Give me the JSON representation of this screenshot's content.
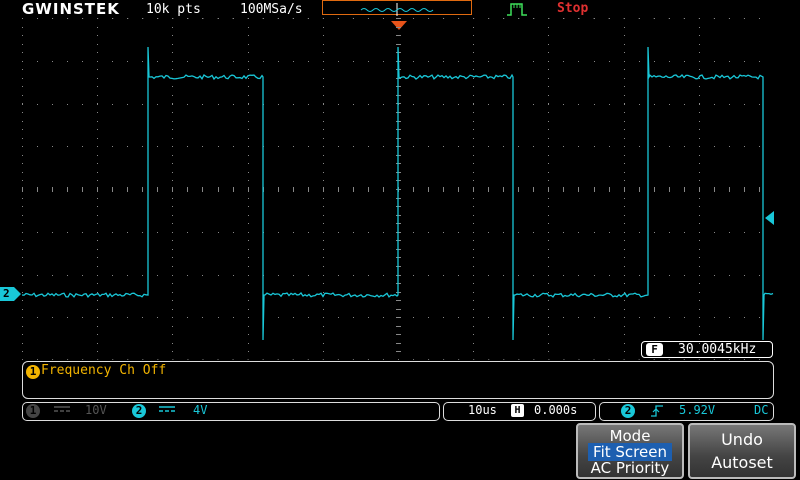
{
  "header": {
    "brand": "GWINSTEK",
    "record_length": "10k pts",
    "sample_rate": "100MSa/s",
    "run_status": "Stop",
    "status_color": "#e03030"
  },
  "waveform": {
    "color": "#19c7d8",
    "signal": "square",
    "cycles_visible": 2.5
  },
  "measurement": {
    "icon_label": "F",
    "frequency": "30.0045kHz"
  },
  "message": {
    "icon": "1",
    "text": "Frequency Ch Off"
  },
  "channels": {
    "ch1": {
      "badge": "1",
      "coupling_icon": "dc-coupling-icon",
      "scale": "10V"
    },
    "ch2": {
      "badge": "2",
      "coupling_icon": "dc-coupling-icon",
      "scale": "4V"
    }
  },
  "ch2_marker_label": "2",
  "timebase": {
    "scale": "10us",
    "h_icon": "H",
    "position": "0.000s"
  },
  "trigger": {
    "source_badge": "2",
    "edge_icon": "rising-edge-icon",
    "level": "5.92V",
    "coupling": "DC"
  },
  "softkeys": {
    "mode": {
      "title": "Mode",
      "options": [
        "Fit Screen",
        "AC Priority"
      ],
      "selected": "Fit Screen"
    },
    "undo": {
      "line1": "Undo",
      "line2": "Autoset"
    }
  }
}
